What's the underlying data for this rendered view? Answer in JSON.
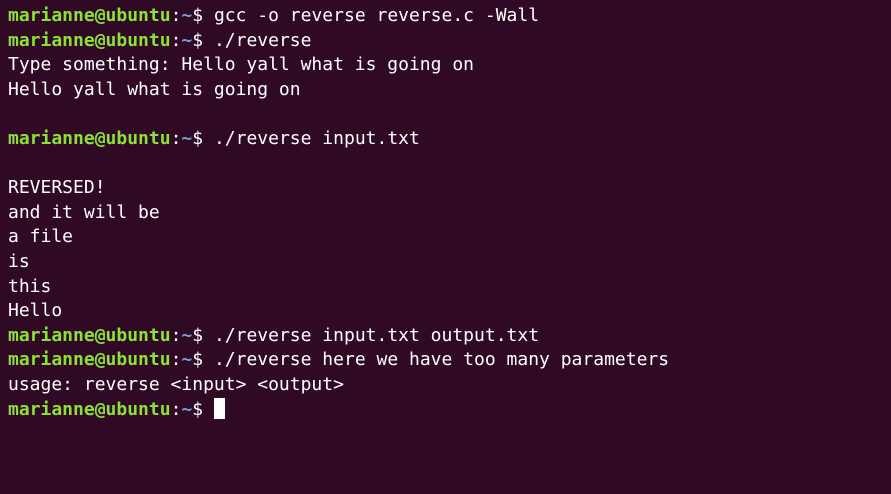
{
  "terminal": {
    "lines": [
      {
        "user": "marianne@ubuntu",
        "sep": ":",
        "path": "~",
        "prompt": "$ ",
        "cmd": "gcc -o reverse reverse.c -Wall"
      },
      {
        "user": "marianne@ubuntu",
        "sep": ":",
        "path": "~",
        "prompt": "$ ",
        "cmd": "./reverse"
      },
      {
        "text": "Type something: Hello yall what is going on"
      },
      {
        "text": "Hello yall what is going on"
      },
      {
        "text": ""
      },
      {
        "user": "marianne@ubuntu",
        "sep": ":",
        "path": "~",
        "prompt": "$ ",
        "cmd": "./reverse input.txt"
      },
      {
        "text": ""
      },
      {
        "text": "REVERSED!"
      },
      {
        "text": "and it will be"
      },
      {
        "text": "a file"
      },
      {
        "text": "is"
      },
      {
        "text": "this"
      },
      {
        "text": "Hello"
      },
      {
        "user": "marianne@ubuntu",
        "sep": ":",
        "path": "~",
        "prompt": "$ ",
        "cmd": "./reverse input.txt output.txt"
      },
      {
        "user": "marianne@ubuntu",
        "sep": ":",
        "path": "~",
        "prompt": "$ ",
        "cmd": "./reverse here we have too many parameters"
      },
      {
        "text": "usage: reverse <input> <output>"
      },
      {
        "user": "marianne@ubuntu",
        "sep": ":",
        "path": "~",
        "prompt": "$ ",
        "cmd": ""
      }
    ]
  },
  "colors": {
    "background": "#300a24",
    "user": "#8ae234",
    "path": "#729fcf",
    "text": "#ffffff"
  }
}
